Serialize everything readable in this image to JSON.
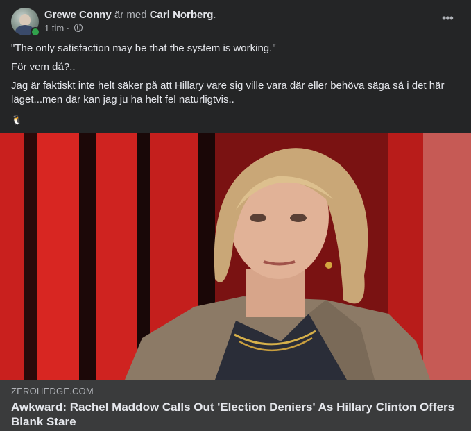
{
  "post": {
    "author": "Grewe Conny",
    "with_text": " är med ",
    "tagged": "Carl Norberg",
    "period": ".",
    "time": "1 tim",
    "separator": " · ",
    "more_icon": "more-horizontal-icon",
    "privacy_icon": "globe-icon",
    "paragraphs": [
      "\"The only satisfaction may be that the system is working.\"",
      "För vem då?..",
      "Jag är faktiskt inte helt säker på att Hillary vare sig ville vara där eller behöva säga så i det här läget...men där kan jag ju ha helt fel naturligtvis.."
    ],
    "emoji": "🐧"
  },
  "link_preview": {
    "domain": "ZEROHEDGE.COM",
    "title": "Awkward: Rachel Maddow Calls Out 'Election Deniers' As Hillary Clinton Offers Blank Stare"
  },
  "colors": {
    "background": "#242526",
    "footer": "#3a3b3c",
    "text_primary": "#e4e6eb",
    "text_secondary": "#b0b3b8",
    "online": "#31a24c"
  }
}
